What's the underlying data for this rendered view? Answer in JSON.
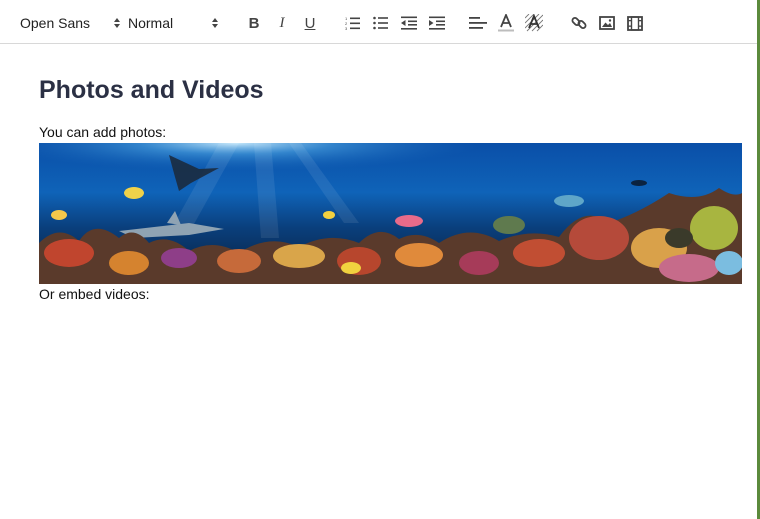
{
  "toolbar": {
    "font_family": "Open Sans",
    "font_size": "Normal",
    "buttons": {
      "bold": "B",
      "italic": "I",
      "underline": "U"
    },
    "icons": [
      "bold-icon",
      "italic-icon",
      "underline-icon",
      "ordered-list-icon",
      "bullet-list-icon",
      "outdent-icon",
      "indent-icon",
      "align-left-icon",
      "text-color-icon",
      "highlight-color-icon",
      "link-icon",
      "image-icon",
      "video-icon"
    ]
  },
  "content": {
    "heading": "Photos and Videos",
    "photos_text": "You can add photos:",
    "videos_text": "Or embed videos:"
  },
  "colors": {
    "heading": "#2b3044",
    "accent_border": "#5b8a3c"
  }
}
